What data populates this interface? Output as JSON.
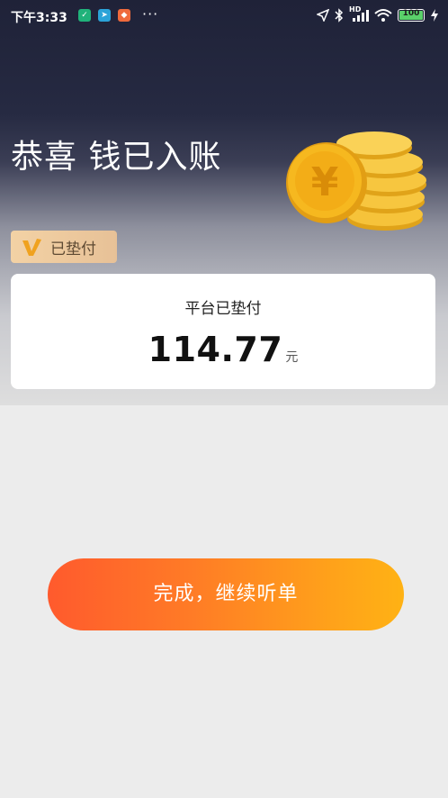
{
  "status_bar": {
    "time": "下午3:33",
    "more": "···",
    "network_label": "HD",
    "battery": "100"
  },
  "header": {
    "title": "恭喜 钱已入账",
    "badge_label": "已垫付",
    "badge_icon_letter": "v",
    "coin_symbol": "¥"
  },
  "card": {
    "label": "平台已垫付",
    "amount": "114.77",
    "unit": "元"
  },
  "actions": {
    "done_label": "完成，继续听单"
  },
  "colors": {
    "badge_gold": "#f3d2a5",
    "cta_start": "#ff5a2d",
    "cta_end": "#ffb214",
    "coin": "#f6b81f"
  }
}
